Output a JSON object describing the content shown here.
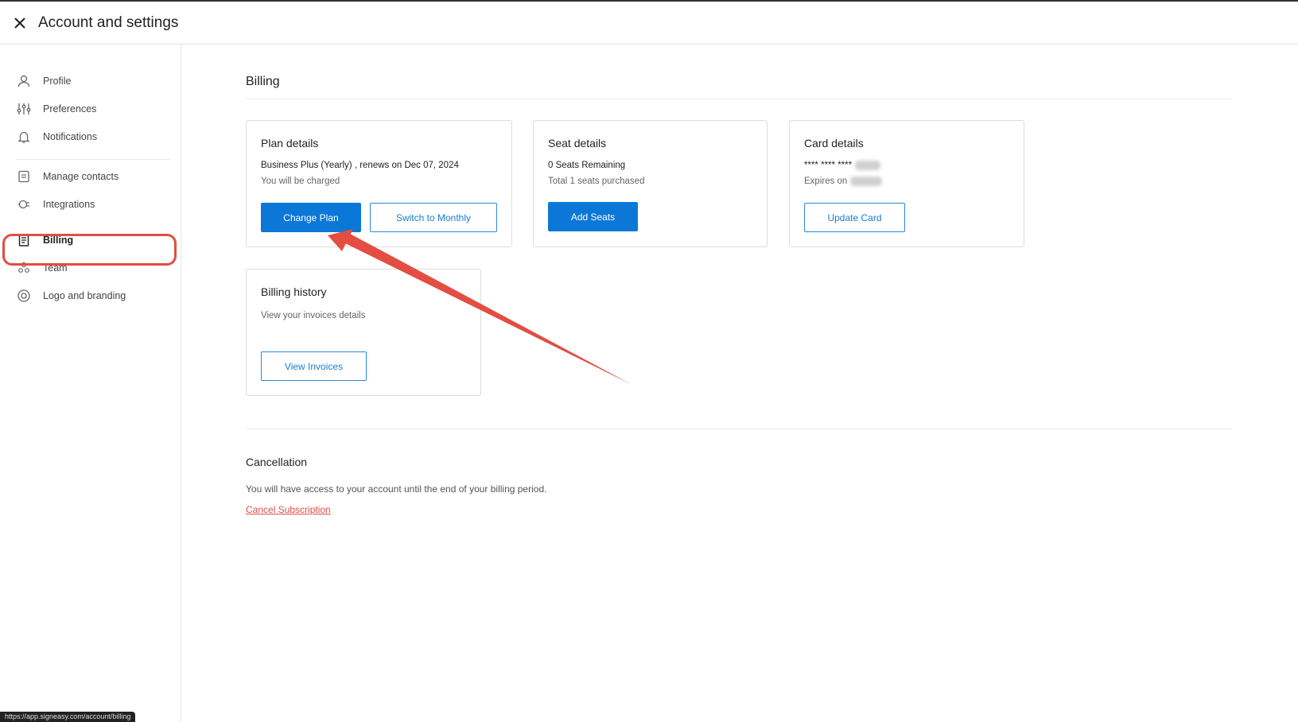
{
  "window": {
    "title": "Account and settings"
  },
  "sidebar": {
    "items": [
      {
        "label": "Profile"
      },
      {
        "label": "Preferences"
      },
      {
        "label": "Notifications"
      },
      {
        "label": "Manage contacts"
      },
      {
        "label": "Integrations"
      },
      {
        "label": "Billing"
      },
      {
        "label": "Team"
      },
      {
        "label": "Logo and branding"
      }
    ],
    "active": "Billing"
  },
  "billing": {
    "title": "Billing",
    "plan": {
      "title": "Plan details",
      "description": "Business Plus (Yearly) , renews on Dec 07, 2024",
      "charge_note": "You will be charged",
      "change_button": "Change Plan",
      "switch_button": "Switch to Monthly"
    },
    "seats": {
      "title": "Seat details",
      "remaining": "0 Seats Remaining",
      "purchased": "Total 1 seats purchased",
      "add_button": "Add Seats"
    },
    "card": {
      "title": "Card details",
      "number_masked": "**** **** ****",
      "expires_label": "Expires on",
      "update_button": "Update Card"
    },
    "history": {
      "title": "Billing history",
      "description": "View your invoices details",
      "view_button": "View Invoices"
    },
    "cancellation": {
      "title": "Cancellation",
      "description": "You will have access to your account until the end of your billing period.",
      "cancel_link": "Cancel Subscription"
    }
  },
  "status_bar": {
    "url": "https://app.signeasy.com/account/billing"
  },
  "colors": {
    "primary": "#0b78d8",
    "annotation": "#e34d42",
    "danger": "#e04e4e"
  }
}
